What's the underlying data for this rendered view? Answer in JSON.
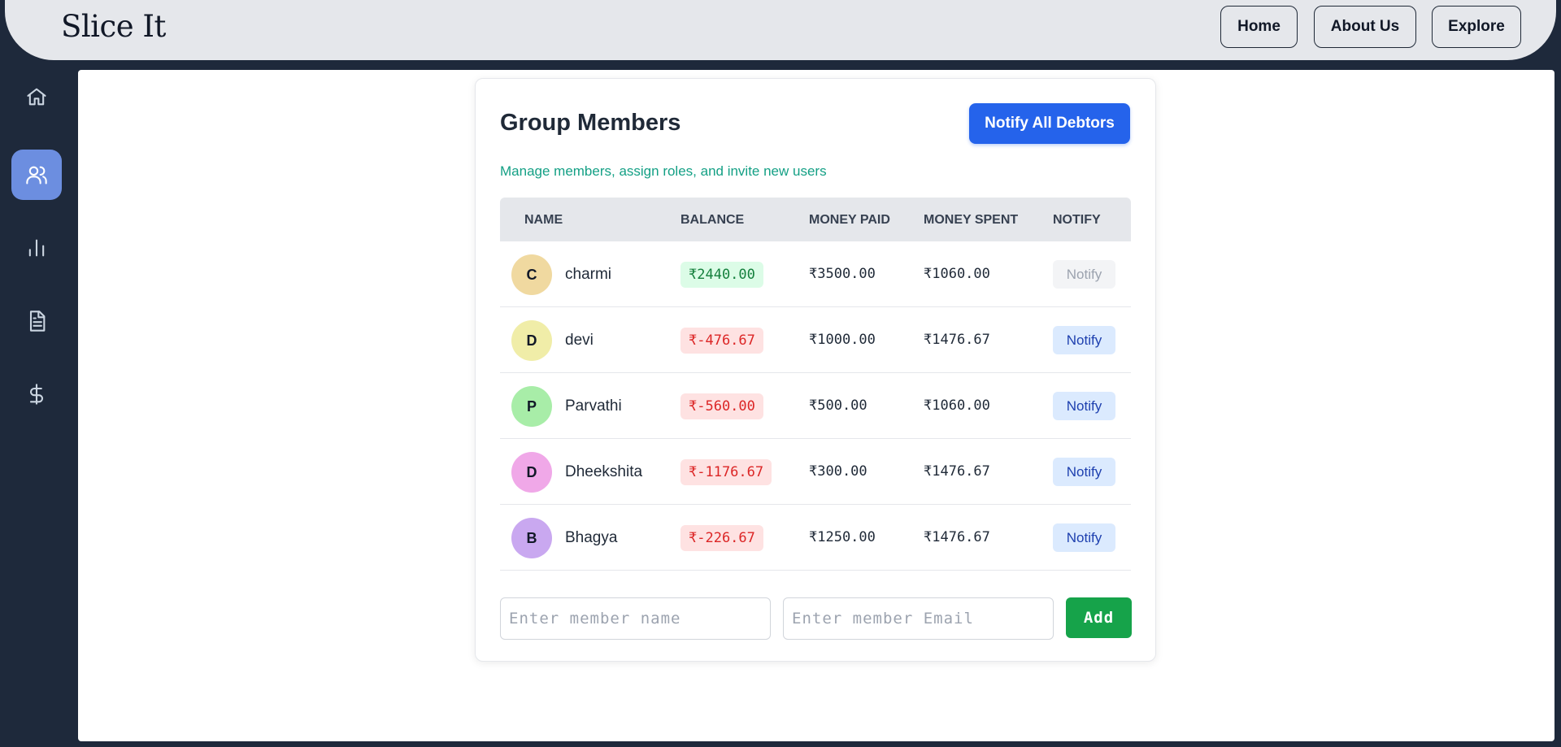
{
  "brand": "Slice It",
  "nav": {
    "home": "Home",
    "about": "About Us",
    "explore": "Explore"
  },
  "sidebar": {
    "items": [
      {
        "icon": "home-icon",
        "active": false
      },
      {
        "icon": "users-icon",
        "active": true
      },
      {
        "icon": "bar-chart-icon",
        "active": false
      },
      {
        "icon": "document-icon",
        "active": false
      },
      {
        "icon": "dollar-icon",
        "active": false
      }
    ]
  },
  "card": {
    "title": "Group Members",
    "notify_all_label": "Notify All Debtors",
    "subtitle": "Manage members, assign roles, and invite new users"
  },
  "table": {
    "headers": [
      "NAME",
      "BALANCE",
      "MONEY PAID",
      "MONEY SPENT",
      "NOTIFY"
    ],
    "rows": [
      {
        "initial": "C",
        "name": "charmi",
        "balance": "₹2440.00",
        "balance_sign": "pos",
        "paid": "₹3500.00",
        "spent": "₹1060.00",
        "notify": "Notify",
        "notify_enabled": false,
        "avatar_color": "#f0d9a0"
      },
      {
        "initial": "D",
        "name": "devi",
        "balance": "₹-476.67",
        "balance_sign": "neg",
        "paid": "₹1000.00",
        "spent": "₹1476.67",
        "notify": "Notify",
        "notify_enabled": true,
        "avatar_color": "#f0eda8"
      },
      {
        "initial": "P",
        "name": "Parvathi",
        "balance": "₹-560.00",
        "balance_sign": "neg",
        "paid": "₹500.00",
        "spent": "₹1060.00",
        "notify": "Notify",
        "notify_enabled": true,
        "avatar_color": "#a8eda8"
      },
      {
        "initial": "D",
        "name": "Dheekshita",
        "balance": "₹-1176.67",
        "balance_sign": "neg",
        "paid": "₹300.00",
        "spent": "₹1476.67",
        "notify": "Notify",
        "notify_enabled": true,
        "avatar_color": "#f0a8e8"
      },
      {
        "initial": "B",
        "name": "Bhagya",
        "balance": "₹-226.67",
        "balance_sign": "neg",
        "paid": "₹1250.00",
        "spent": "₹1476.67",
        "notify": "Notify",
        "notify_enabled": true,
        "avatar_color": "#c9a8f0"
      }
    ]
  },
  "form": {
    "name_placeholder": "Enter member name",
    "email_placeholder": "Enter member Email",
    "add_label": "Add"
  }
}
